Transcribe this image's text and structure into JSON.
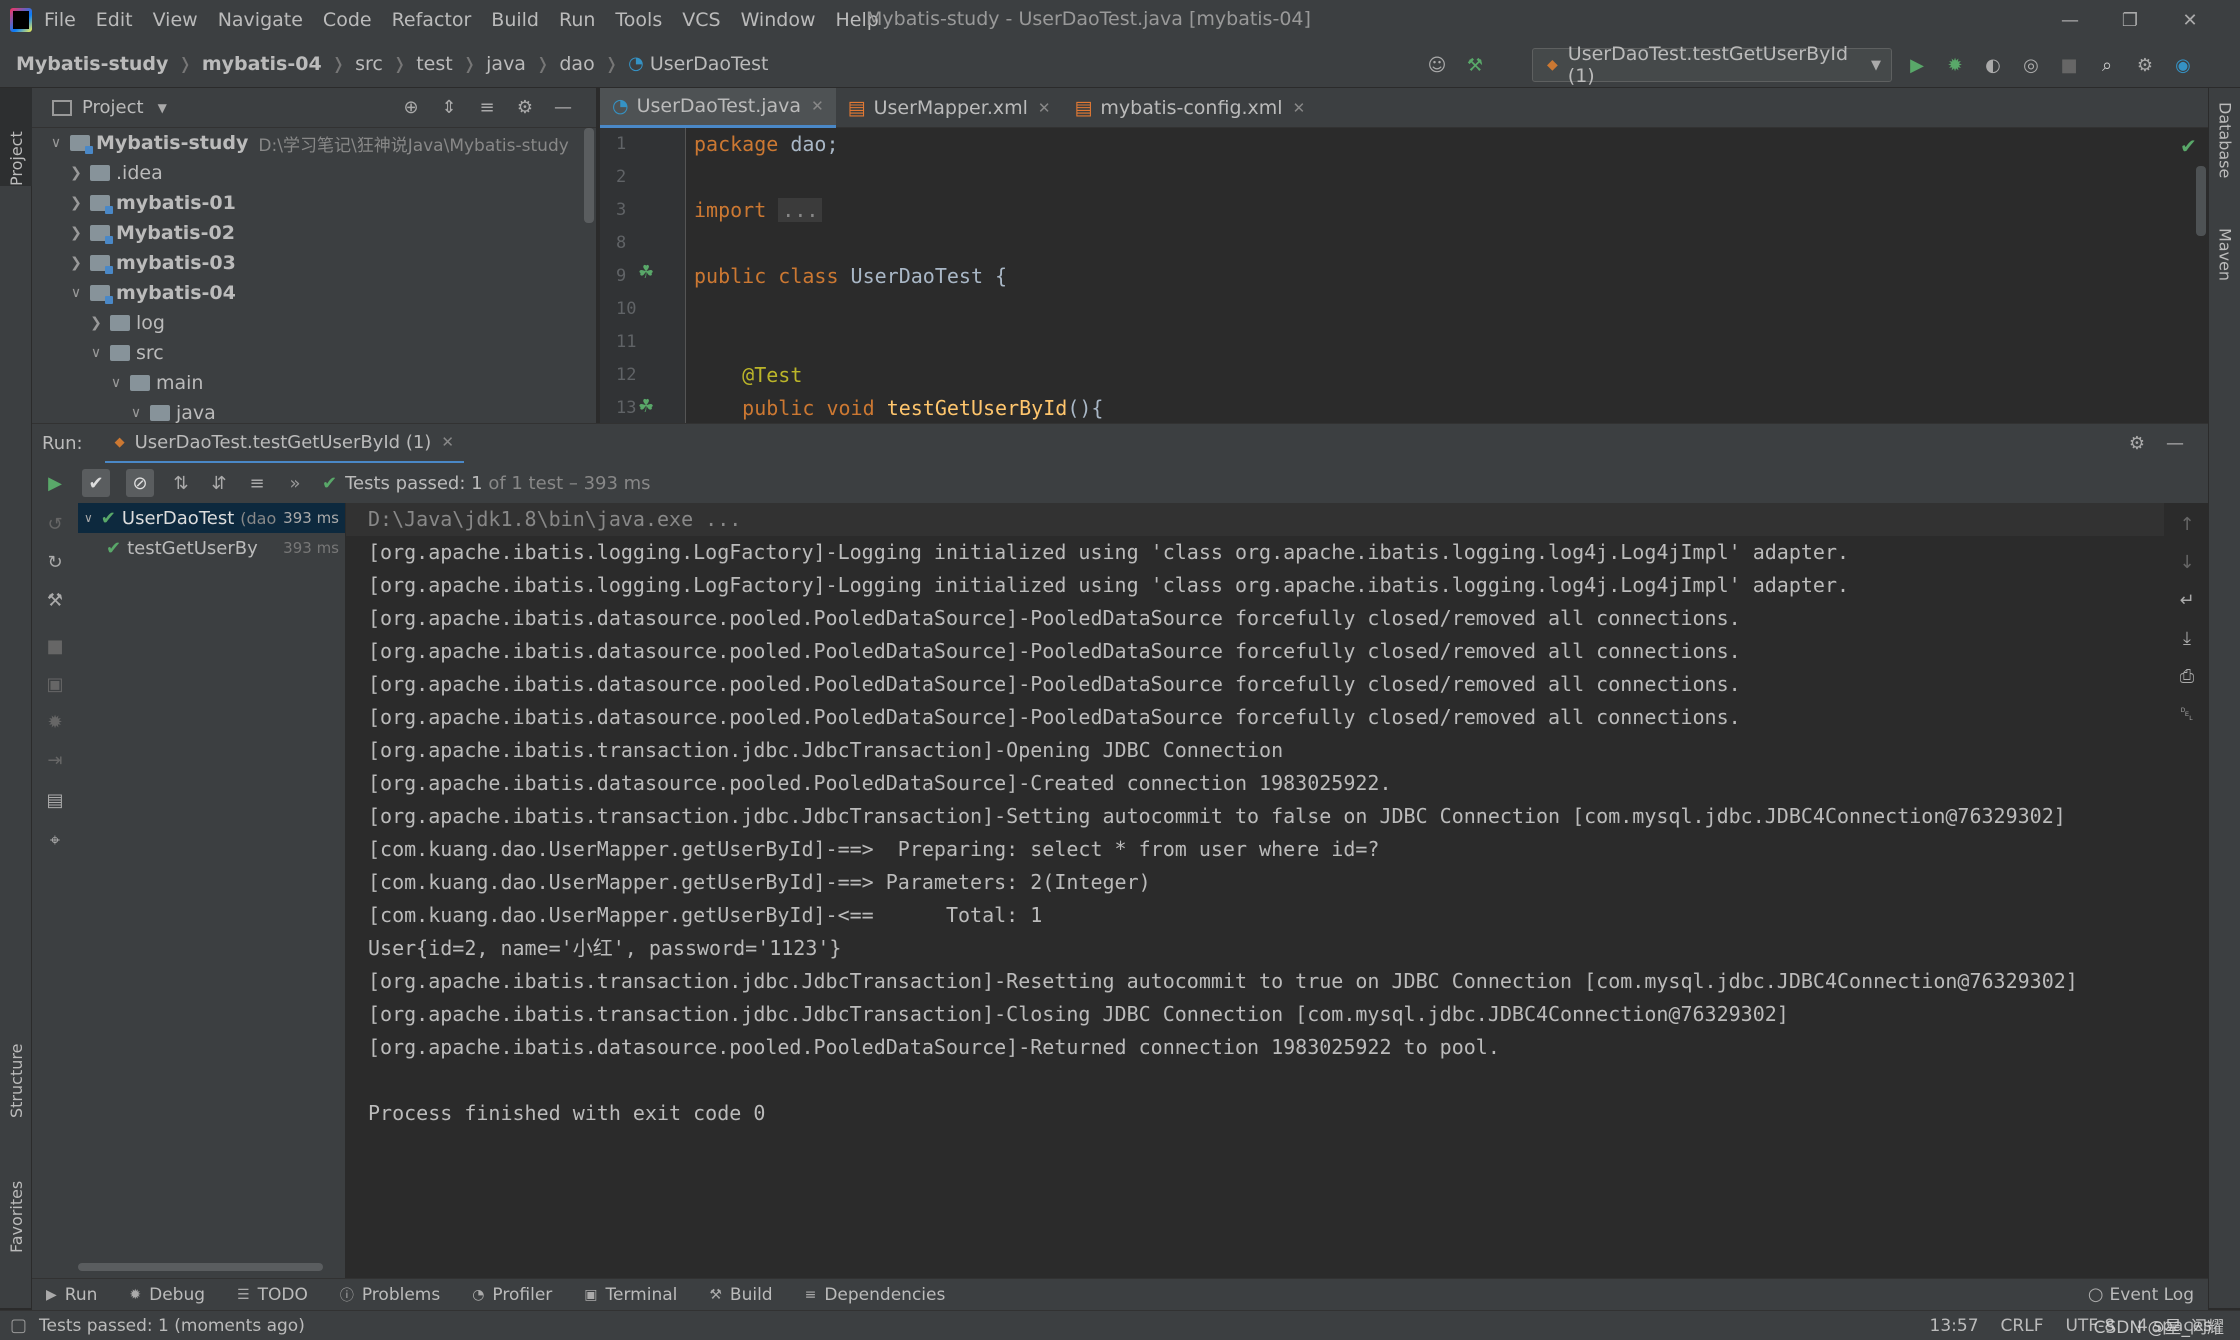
{
  "menu": {
    "items": [
      "File",
      "Edit",
      "View",
      "Navigate",
      "Code",
      "Refactor",
      "Build",
      "Run",
      "Tools",
      "VCS",
      "Window",
      "Help"
    ],
    "window_title": "Mybatis-study - UserDaoTest.java [mybatis-04]"
  },
  "breadcrumb": {
    "items": [
      "Mybatis-study",
      "mybatis-04",
      "src",
      "test",
      "java",
      "dao",
      "UserDaoTest"
    ]
  },
  "run_config": {
    "label": "UserDaoTest.testGetUserById (1)"
  },
  "left_stripe": {
    "project": "Project",
    "structure": "Structure",
    "favorites": "Favorites"
  },
  "right_stripe": {
    "database": "Database",
    "maven": "Maven"
  },
  "project_panel": {
    "title": "Project",
    "tree": [
      {
        "label": "Mybatis-study",
        "note": "D:\\学习笔记\\狂神说Java\\Mybatis-study",
        "depth": 0,
        "expanded": true,
        "bold": true,
        "module": true
      },
      {
        "label": ".idea",
        "depth": 1,
        "expanded": false,
        "bold": false,
        "module": false
      },
      {
        "label": "mybatis-01",
        "depth": 1,
        "expanded": false,
        "bold": true,
        "module": true
      },
      {
        "label": "Mybatis-02",
        "depth": 1,
        "expanded": false,
        "bold": true,
        "module": true
      },
      {
        "label": "mybatis-03",
        "depth": 1,
        "expanded": false,
        "bold": true,
        "module": true
      },
      {
        "label": "mybatis-04",
        "depth": 1,
        "expanded": true,
        "bold": true,
        "module": true
      },
      {
        "label": "log",
        "depth": 2,
        "expanded": false,
        "bold": false,
        "module": false
      },
      {
        "label": "src",
        "depth": 2,
        "expanded": true,
        "bold": false,
        "module": false
      },
      {
        "label": "main",
        "depth": 3,
        "expanded": true,
        "bold": false,
        "module": false
      },
      {
        "label": "java",
        "depth": 4,
        "expanded": true,
        "bold": false,
        "module": false
      }
    ]
  },
  "editor": {
    "tabs": [
      {
        "label": "UserDaoTest.java",
        "active": true,
        "kind": "java"
      },
      {
        "label": "UserMapper.xml",
        "active": false,
        "kind": "xml"
      },
      {
        "label": "mybatis-config.xml",
        "active": false,
        "kind": "xml"
      }
    ],
    "line_numbers": [
      "1",
      "2",
      "3",
      "8",
      "9",
      "10",
      "11",
      "12",
      "13"
    ],
    "lines": [
      "package dao;",
      "",
      "import ...",
      "",
      "public class UserDaoTest {",
      "",
      "",
      "    @Test",
      "    public void testGetUserById(){"
    ]
  },
  "run_panel": {
    "label": "Run:",
    "tab": "UserDaoTest.testGetUserById (1)",
    "status_main": "Tests passed: 1",
    "status_rest": " of 1 test – 393 ms",
    "tests": [
      {
        "label": "UserDaoTest",
        "extra": "(dao",
        "time": "393 ms"
      },
      {
        "label": "testGetUserBy",
        "extra": "",
        "time": "393 ms"
      }
    ],
    "console": [
      "D:\\Java\\jdk1.8\\bin\\java.exe ...",
      "[org.apache.ibatis.logging.LogFactory]-Logging initialized using 'class org.apache.ibatis.logging.log4j.Log4jImpl' adapter.",
      "[org.apache.ibatis.logging.LogFactory]-Logging initialized using 'class org.apache.ibatis.logging.log4j.Log4jImpl' adapter.",
      "[org.apache.ibatis.datasource.pooled.PooledDataSource]-PooledDataSource forcefully closed/removed all connections.",
      "[org.apache.ibatis.datasource.pooled.PooledDataSource]-PooledDataSource forcefully closed/removed all connections.",
      "[org.apache.ibatis.datasource.pooled.PooledDataSource]-PooledDataSource forcefully closed/removed all connections.",
      "[org.apache.ibatis.datasource.pooled.PooledDataSource]-PooledDataSource forcefully closed/removed all connections.",
      "[org.apache.ibatis.transaction.jdbc.JdbcTransaction]-Opening JDBC Connection",
      "[org.apache.ibatis.datasource.pooled.PooledDataSource]-Created connection 1983025922.",
      "[org.apache.ibatis.transaction.jdbc.JdbcTransaction]-Setting autocommit to false on JDBC Connection [com.mysql.jdbc.JDBC4Connection@76329302]",
      "[com.kuang.dao.UserMapper.getUserById]-==>  Preparing: select * from user where id=?",
      "[com.kuang.dao.UserMapper.getUserById]-==> Parameters: 2(Integer)",
      "[com.kuang.dao.UserMapper.getUserById]-<==      Total: 1",
      "User{id=2, name='小红', password='1123'}",
      "[org.apache.ibatis.transaction.jdbc.JdbcTransaction]-Resetting autocommit to true on JDBC Connection [com.mysql.jdbc.JDBC4Connection@76329302]",
      "[org.apache.ibatis.transaction.jdbc.JdbcTransaction]-Closing JDBC Connection [com.mysql.jdbc.JDBC4Connection@76329302]",
      "[org.apache.ibatis.datasource.pooled.PooledDataSource]-Returned connection 1983025922 to pool.",
      "",
      "Process finished with exit code 0"
    ]
  },
  "bottom_tabs": [
    {
      "label": "Run",
      "icon": "play-icon"
    },
    {
      "label": "Debug",
      "icon": "bug-icon"
    },
    {
      "label": "TODO",
      "icon": "list-icon"
    },
    {
      "label": "Problems",
      "icon": "info-icon"
    },
    {
      "label": "Profiler",
      "icon": "profiler-icon"
    },
    {
      "label": "Terminal",
      "icon": "terminal-icon"
    },
    {
      "label": "Build",
      "icon": "hammer-icon"
    },
    {
      "label": "Dependencies",
      "icon": "layers-icon"
    }
  ],
  "event_log": "Event Log",
  "status_bar": {
    "message": "Tests passed: 1 (moments ago)",
    "time": "13:57",
    "line_sep": "CRLF",
    "encoding": "UTF-8",
    "indent": "4 spaces",
    "watermark": "CSDN @星_闪耀"
  },
  "colors": {
    "accent": "#4a88c7",
    "green": "#59a869",
    "keyword": "#cc7832",
    "annotation": "#bbb529",
    "function": "#ffc66d"
  }
}
